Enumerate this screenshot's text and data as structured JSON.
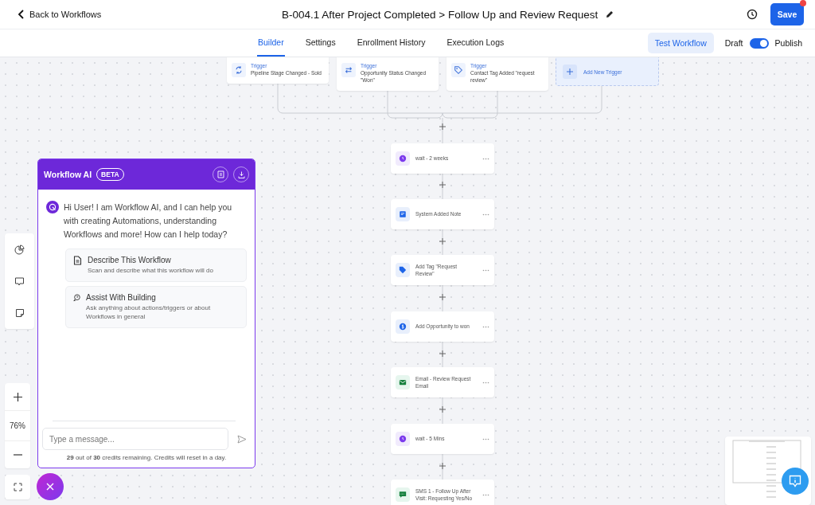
{
  "header": {
    "back_link": "Back to Workflows",
    "title": "B-004.1 After Project Completed > Follow Up and Review Request",
    "save_button": "Save"
  },
  "tabs": [
    {
      "label": "Builder",
      "selected": true
    },
    {
      "label": "Settings",
      "selected": false
    },
    {
      "label": "Enrollment History",
      "selected": false
    },
    {
      "label": "Execution Logs",
      "selected": false
    }
  ],
  "test_button": "Test Workflow",
  "draft_label": "Draft",
  "publish_toggle": {
    "on": true
  },
  "publish_label": "Publish",
  "triggers": [
    {
      "kind": "pipeline",
      "label": "Trigger",
      "text": "Pipeline Stage Changed - Sold"
    },
    {
      "kind": "status",
      "label": "Trigger",
      "text": "Opportunity Status Changed \"Won\""
    },
    {
      "kind": "tag",
      "label": "Trigger",
      "text": "Contact Tag Added \"request review\""
    }
  ],
  "add_trigger": "Add New Trigger",
  "actions": [
    {
      "kind": "wait",
      "text": "wait - 2 weeks"
    },
    {
      "kind": "note",
      "text": "System Added Note"
    },
    {
      "kind": "tag",
      "text": "Add Tag \"Request Review\""
    },
    {
      "kind": "opportunity",
      "text": "Add Opportunity to won"
    },
    {
      "kind": "email",
      "text": "Email - Review Request Email"
    },
    {
      "kind": "wait",
      "text": "wait - 5 Mins"
    },
    {
      "kind": "sms",
      "text": "SMS 1 - Follow Up After Visit: Requesting Yes/No"
    }
  ],
  "ai_panel": {
    "title": "Workflow AI",
    "badge": "BETA",
    "message": "Hi User! I am Workflow AI, and I can help you with creating Automations, understanding Workflows and more! How can I help today?",
    "suggestions": [
      {
        "kind": "describe",
        "title": "Describe This Workflow",
        "description": "Scan and describe what this workflow will do"
      },
      {
        "kind": "assist",
        "title": "Assist With Building",
        "description": "Ask anything about actions/triggers or about Workflows in general"
      }
    ],
    "input": {
      "placeholder": "Type a message..."
    },
    "credits": "**29** out of **30** credits remaining. Credits will reset in a day."
  },
  "zoom_level": "76%"
}
